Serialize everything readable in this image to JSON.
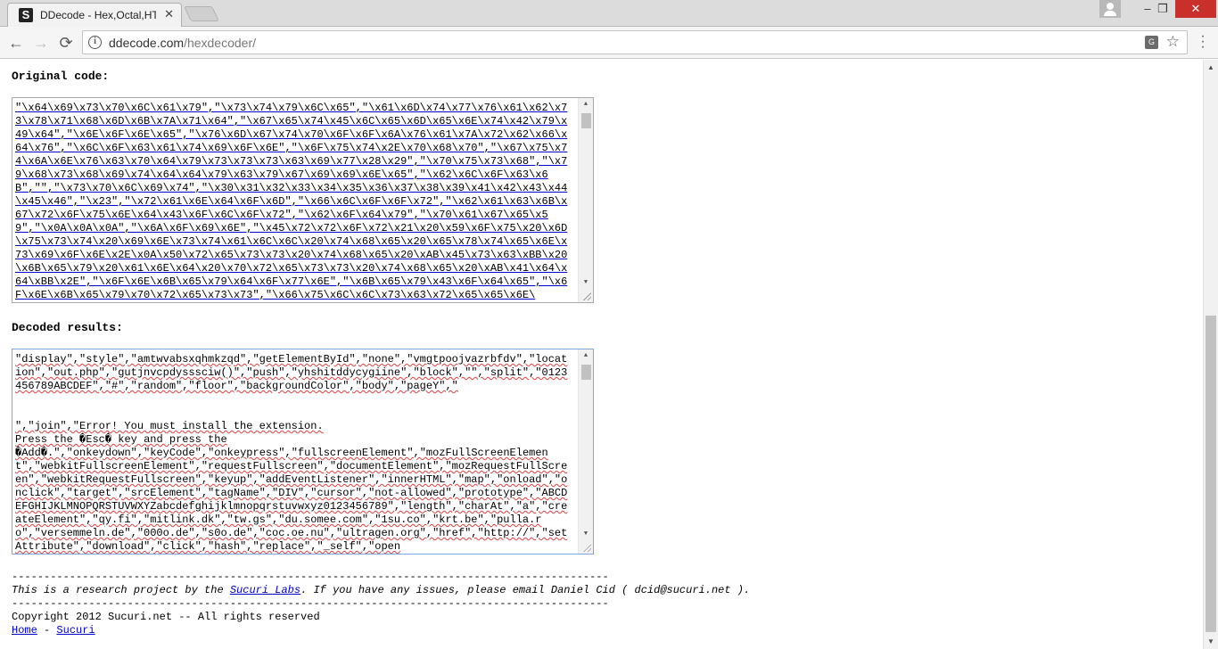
{
  "browser": {
    "tab_title": "DDecode - Hex,Octal,HTML",
    "tab_favicon": "S",
    "url_host": "ddecode.com",
    "url_path": "/hexdecoder/",
    "window_controls": [
      "–",
      "❐",
      "✕"
    ]
  },
  "original": {
    "heading": "Original code:",
    "text": "\"\\x64\\x69\\x73\\x70\\x6C\\x61\\x79\",\"\\x73\\x74\\x79\\x6C\\x65\",\"\\x61\\x6D\\x74\\x77\\x76\\x61\\x62\\x73\\x78\\x71\\x68\\x6D\\x6B\\x7A\\x71\\x64\",\"\\x67\\x65\\x74\\x45\\x6C\\x65\\x6D\\x65\\x6E\\x74\\x42\\x79\\x49\\x64\",\"\\x6E\\x6F\\x6E\\x65\",\"\\x76\\x6D\\x67\\x74\\x70\\x6F\\x6F\\x6A\\x76\\x61\\x7A\\x72\\x62\\x66\\x64\\x76\",\"\\x6C\\x6F\\x63\\x61\\x74\\x69\\x6F\\x6E\",\"\\x6F\\x75\\x74\\x2E\\x70\\x68\\x70\",\"\\x67\\x75\\x74\\x6A\\x6E\\x76\\x63\\x70\\x64\\x79\\x73\\x73\\x73\\x63\\x69\\x77\\x28\\x29\",\"\\x70\\x75\\x73\\x68\",\"\\x79\\x68\\x73\\x68\\x69\\x74\\x64\\x64\\x79\\x63\\x79\\x67\\x69\\x69\\x6E\\x65\",\"\\x62\\x6C\\x6F\\x63\\x6B\",\"\",\"\\x73\\x70\\x6C\\x69\\x74\",\"\\x30\\x31\\x32\\x33\\x34\\x35\\x36\\x37\\x38\\x39\\x41\\x42\\x43\\x44\\x45\\x46\",\"\\x23\",\"\\x72\\x61\\x6E\\x64\\x6F\\x6D\",\"\\x66\\x6C\\x6F\\x6F\\x72\",\"\\x62\\x61\\x63\\x6B\\x67\\x72\\x6F\\x75\\x6E\\x64\\x43\\x6F\\x6C\\x6F\\x72\",\"\\x62\\x6F\\x64\\x79\",\"\\x70\\x61\\x67\\x65\\x59\",\"\\x0A\\x0A\\x0A\",\"\\x6A\\x6F\\x69\\x6E\",\"\\x45\\x72\\x72\\x6F\\x72\\x21\\x20\\x59\\x6F\\x75\\x20\\x6D\\x75\\x73\\x74\\x20\\x69\\x6E\\x73\\x74\\x61\\x6C\\x6C\\x20\\x74\\x68\\x65\\x20\\x65\\x78\\x74\\x65\\x6E\\x73\\x69\\x6F\\x6E\\x2E\\x0A\\x50\\x72\\x65\\x73\\x73\\x20\\x74\\x68\\x65\\x20\\xAB\\x45\\x73\\x63\\xBB\\x20\\x6B\\x65\\x79\\x20\\x61\\x6E\\x64\\x20\\x70\\x72\\x65\\x73\\x73\\x20\\x74\\x68\\x65\\x20\\xAB\\x41\\x64\\x64\\xBB\\x2E\",\"\\x6F\\x6E\\x6B\\x65\\x79\\x64\\x6F\\x77\\x6E\",\"\\x6B\\x65\\x79\\x43\\x6F\\x64\\x65\",\"\\x6F\\x6E\\x6B\\x65\\x79\\x70\\x72\\x65\\x73\\x73\",\"\\x66\\x75\\x6C\\x6C\\x73\\x63\\x72\\x65\\x65\\x6E\\"
  },
  "decoded": {
    "heading": "Decoded results:",
    "text": "\"display\",\"style\",\"amtwvabsxqhmkzqd\",\"getElementById\",\"none\",\"vmgtpoojvazrbfdv\",\"location\",\"out.php\",\"gutjnvcpdysssciw()\",\"push\",\"yhshitddycygiine\",\"block\",\"\",\"split\",\"0123456789ABCDEF\",\"#\",\"random\",\"floor\",\"backgroundColor\",\"body\",\"pageY\",\"\n\n\n\",\"join\",\"Error! You must install the extension.\nPress the �Esc� key and press the\n�Add�.\",\"onkeydown\",\"keyCode\",\"onkeypress\",\"fullscreenElement\",\"mozFullScreenElement\",\"webkitFullscreenElement\",\"requestFullscreen\",\"documentElement\",\"mozRequestFullScreen\",\"webkitRequestFullscreen\",\"keyup\",\"addEventListener\",\"innerHTML\",\"map\",\"onload\",\"onclick\",\"target\",\"srcElement\",\"tagName\",\"DIV\",\"cursor\",\"not-allowed\",\"prototype\",\"ABCDEFGHIJKLMNOPQRSTUVWXYZabcdefghijklmnopqrstuvwxyz0123456789\",\"length\",\"charAt\",\"a\",\"createElement\",\"qy.fi\",\"mitlink.dk\",\"tw.gs\",\"du.somee.com\",\"1su.co\",\"krt.be\",\"pulla.ro\",\"versemmeln.de\",\"000o.de\",\"s0o.de\",\"coc.oe.nu\",\"ultragen.org\",\"href\",\"http://\",\"setAttribute\",\"download\",\"click\",\"hash\",\"replace\",\"_self\",\"open"
  },
  "footer": {
    "rule": "---------------------------------------------------------------------------------------------",
    "research_prefix": "This is a research project by the ",
    "research_link": "Sucuri Labs",
    "research_suffix": ". If you have any issues, please email Daniel Cid ( dcid@sucuri.net ).",
    "copyright": "Copyright 2012 Sucuri.net -- All rights reserved",
    "home_link": "Home",
    "separator": " - ",
    "sucuri_link": "Sucuri"
  },
  "icons": {
    "back": "←",
    "forward": "→",
    "reload": "⟳",
    "star": "☆",
    "close": "✕"
  }
}
